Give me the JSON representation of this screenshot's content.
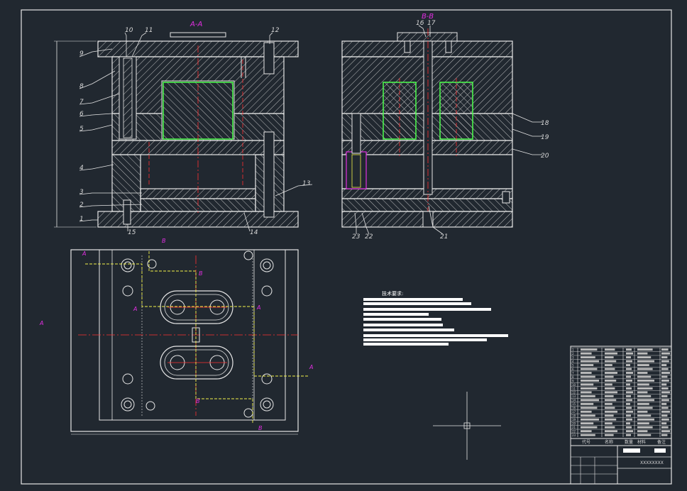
{
  "drawing": {
    "section_labels": {
      "aa": "A-A",
      "bb": "B-B"
    },
    "left_part_numbers": [
      "9",
      "8",
      "7",
      "6",
      "5",
      "4",
      "3",
      "2",
      "1"
    ],
    "top_part_numbers": [
      "10",
      "11",
      "12"
    ],
    "bottom_part_numbers": [
      "15",
      "14"
    ],
    "leader_13": "13",
    "right_part_numbers": [
      "18",
      "19",
      "20"
    ],
    "top_right_numbers": [
      "16",
      "17"
    ],
    "bottom_right_numbers": [
      "23",
      "22",
      "21"
    ],
    "plan_labels": {
      "a": "A",
      "b": "B"
    },
    "notes_title": "技术要求:",
    "title_block": {
      "row_marks": [
        "1",
        "2",
        "3",
        "4",
        "5",
        "6",
        "7",
        "8",
        "9",
        "10",
        "11",
        "12",
        "13",
        "14",
        "15",
        "16",
        "17",
        "18",
        "19",
        "20",
        "21",
        "22",
        "23"
      ],
      "headers": [
        "代号",
        "名称",
        "数量",
        "材料",
        "备注"
      ],
      "drawing_no": "XXXXXXXX"
    }
  },
  "colors": {
    "background": "#212830",
    "line": "#e6e6e6",
    "hatch": "#cfcfcf",
    "label": "#d6d6d6",
    "magenta": "#e22ee2",
    "yellow": "#f2f24a",
    "red": "#ff3030",
    "green": "#4cff4c"
  }
}
